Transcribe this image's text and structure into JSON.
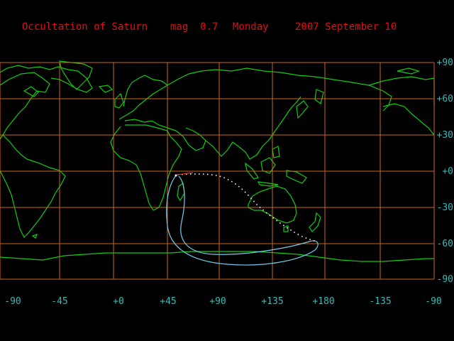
{
  "title": {
    "event": "Occultation of Saturn",
    "magnitude": "mag  0.7",
    "weekday": "Monday",
    "date": "2007 September 10"
  },
  "axes": {
    "lat_labels": [
      "+90",
      "+60",
      "+30",
      "+0",
      "-30",
      "-60",
      "-90"
    ],
    "lon_labels": [
      "-90",
      "-45",
      "+0",
      "+45",
      "+90",
      "+135",
      "+180",
      "-135",
      "-90"
    ]
  },
  "colors": {
    "title": "#dd1111",
    "grid": "#cc6622",
    "coast": "#11cc11",
    "axis_labels": "#33bbbb",
    "track_south": "#77ccee",
    "track_north": "#ffffff",
    "track_start": "#dd3333"
  }
}
